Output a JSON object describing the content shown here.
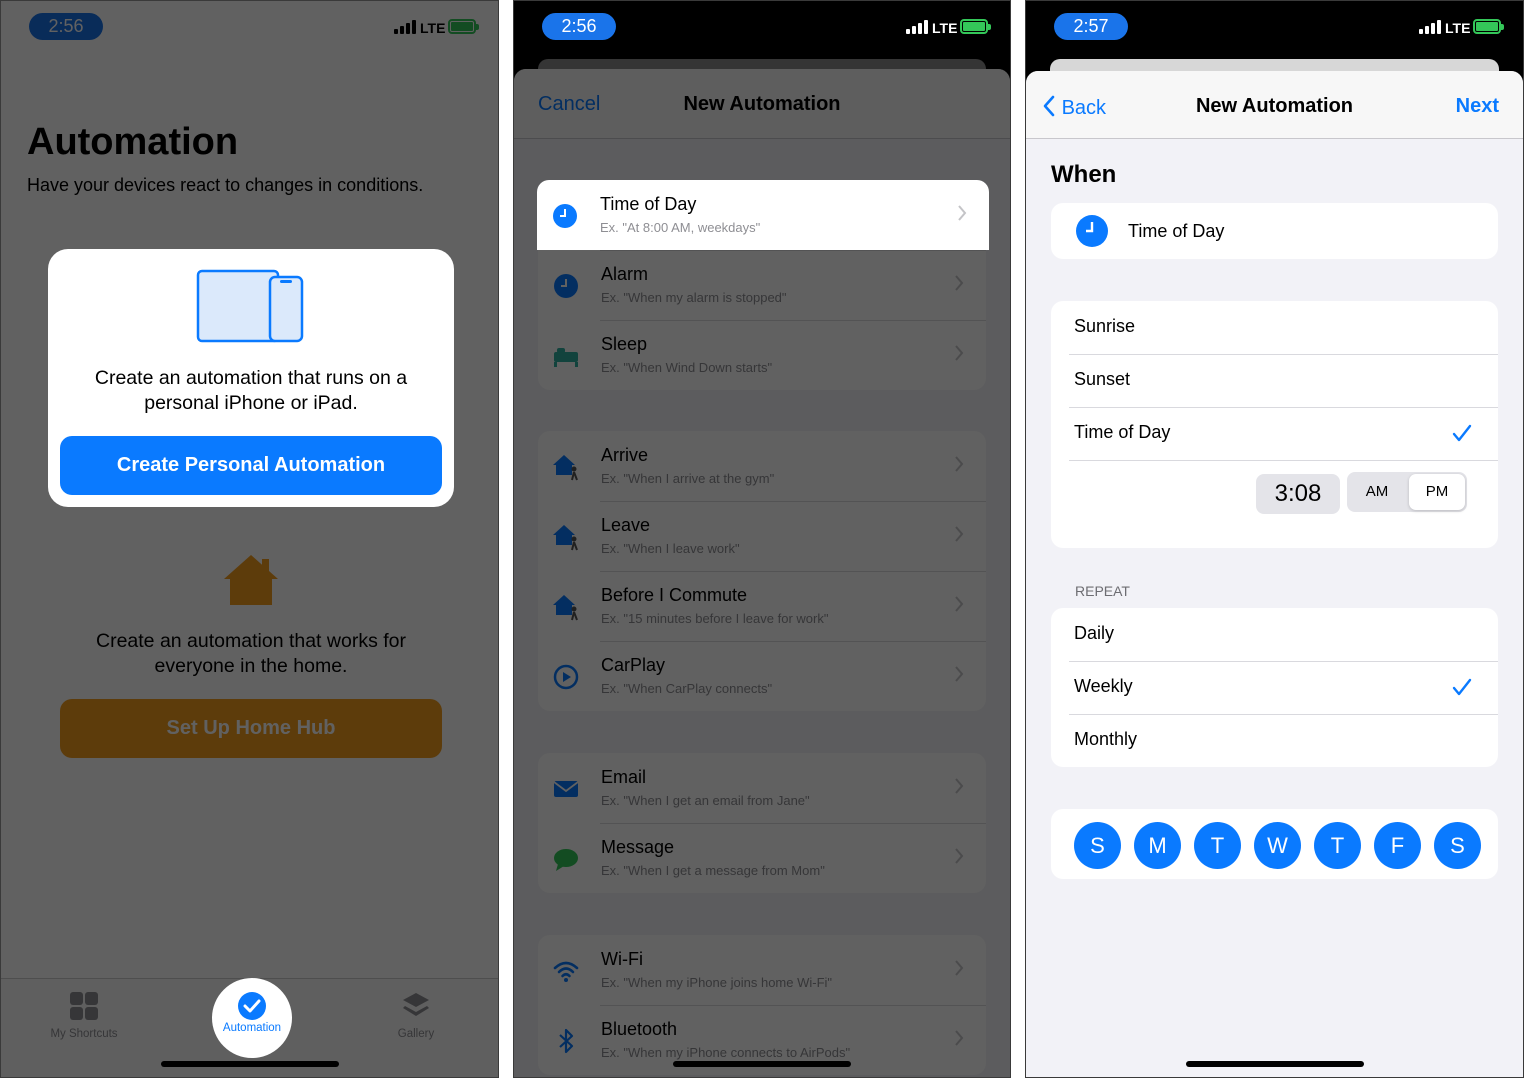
{
  "phone1": {
    "time": "2:56",
    "network": "LTE",
    "title": "Automation",
    "subtitle": "Have your devices react to changes in conditions.",
    "personal_card": {
      "description": "Create an automation that runs on a personal iPhone or iPad.",
      "button": "Create Personal Automation"
    },
    "home_card": {
      "description": "Create an automation that works for everyone in the home.",
      "button": "Set Up Home Hub"
    },
    "tabs": [
      {
        "label": "My Shortcuts",
        "icon": "grid-icon"
      },
      {
        "label": "Automation",
        "icon": "automation-check-icon",
        "active": true
      },
      {
        "label": "Gallery",
        "icon": "layers-icon"
      }
    ]
  },
  "phone2": {
    "time": "2:56",
    "network": "LTE",
    "nav": {
      "cancel": "Cancel",
      "title": "New Automation"
    },
    "groups": [
      [
        {
          "title": "Time of Day",
          "subtitle": "Ex. \"At 8:00 AM, weekdays\"",
          "icon": "clock-icon"
        },
        {
          "title": "Alarm",
          "subtitle": "Ex. \"When my alarm is stopped\"",
          "icon": "alarm-clock-icon"
        },
        {
          "title": "Sleep",
          "subtitle": "Ex. \"When Wind Down starts\"",
          "icon": "bed-icon"
        }
      ],
      [
        {
          "title": "Arrive",
          "subtitle": "Ex. \"When I arrive at the gym\"",
          "icon": "house-person-icon"
        },
        {
          "title": "Leave",
          "subtitle": "Ex. \"When I leave work\"",
          "icon": "house-person-icon"
        },
        {
          "title": "Before I Commute",
          "subtitle": "Ex. \"15 minutes before I leave for work\"",
          "icon": "house-person-icon"
        },
        {
          "title": "CarPlay",
          "subtitle": "Ex. \"When CarPlay connects\"",
          "icon": "carplay-icon"
        }
      ],
      [
        {
          "title": "Email",
          "subtitle": "Ex. \"When I get an email from Jane\"",
          "icon": "envelope-icon"
        },
        {
          "title": "Message",
          "subtitle": "Ex. \"When I get a message from Mom\"",
          "icon": "message-bubble-icon"
        }
      ],
      [
        {
          "title": "Wi-Fi",
          "subtitle": "Ex. \"When my iPhone joins home Wi-Fi\"",
          "icon": "wifi-icon"
        },
        {
          "title": "Bluetooth",
          "subtitle": "Ex. \"When my iPhone connects to AirPods\"",
          "icon": "bluetooth-icon"
        }
      ]
    ]
  },
  "phone3": {
    "time": "2:57",
    "network": "LTE",
    "nav": {
      "back": "Back",
      "title": "New Automation",
      "next": "Next"
    },
    "when_label": "When",
    "trigger": "Time of Day",
    "options": [
      "Sunrise",
      "Sunset",
      "Time of Day"
    ],
    "selected_option": "Time of Day",
    "time_value": "3:08",
    "am": "AM",
    "pm": "PM",
    "selected_period": "PM",
    "repeat_label": "REPEAT",
    "repeat_options": [
      "Daily",
      "Weekly",
      "Monthly"
    ],
    "selected_repeat": "Weekly",
    "days": [
      "S",
      "M",
      "T",
      "W",
      "T",
      "F",
      "S"
    ]
  },
  "colors": {
    "accent": "#0a7aff",
    "home_orange": "#f49d1d",
    "battery_green": "#34c759"
  }
}
